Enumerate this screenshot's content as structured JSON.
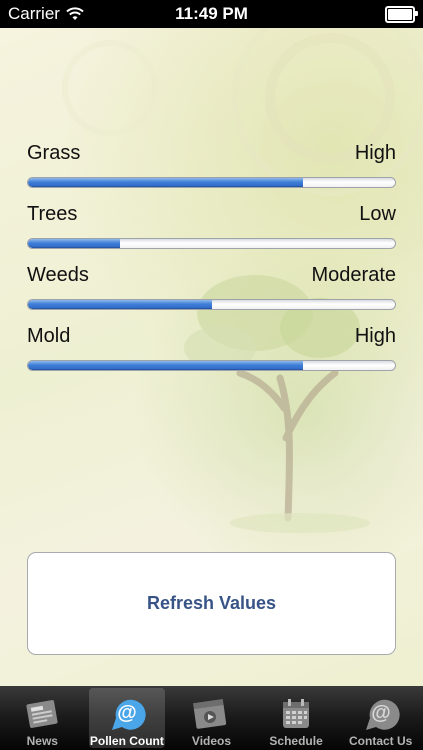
{
  "status_bar": {
    "carrier": "Carrier",
    "time": "11:49 PM"
  },
  "pollen": [
    {
      "label": "Grass",
      "level": "High",
      "fill": 0.75
    },
    {
      "label": "Trees",
      "level": "Low",
      "fill": 0.25
    },
    {
      "label": "Weeds",
      "level": "Moderate",
      "fill": 0.5
    },
    {
      "label": "Mold",
      "level": "High",
      "fill": 0.75
    }
  ],
  "refresh_button": {
    "label": "Refresh Values"
  },
  "tabs": [
    {
      "label": "News",
      "icon": "newspaper-icon"
    },
    {
      "label": "Pollen Count",
      "icon": "at-sign-icon",
      "active": true
    },
    {
      "label": "Videos",
      "icon": "film-icon"
    },
    {
      "label": "Schedule",
      "icon": "calendar-icon"
    },
    {
      "label": "Contact Us",
      "icon": "at-sign-icon"
    }
  ],
  "colors": {
    "accent_blue": "#3f7fd7",
    "button_text": "#385487"
  }
}
